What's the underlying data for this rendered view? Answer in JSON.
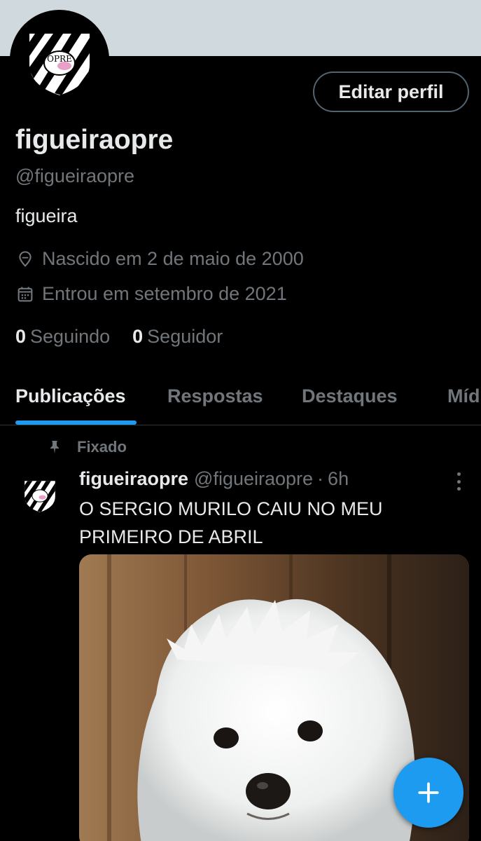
{
  "profile": {
    "display_name": "figueiraopre",
    "handle": "@figueiraopre",
    "bio": "figueira",
    "birth": "Nascido em 2 de maio de 2000",
    "joined": "Entrou em setembro de 2021",
    "following_count": "0",
    "following_label": "Seguindo",
    "followers_count": "0",
    "followers_label": "Seguidor",
    "edit_label": "Editar perfil",
    "avatar_text": "OPRE"
  },
  "tabs": [
    {
      "label": "Publicações",
      "active": true
    },
    {
      "label": "Respostas",
      "active": false
    },
    {
      "label": "Destaques",
      "active": false
    },
    {
      "label": "Míd",
      "active": false
    }
  ],
  "post": {
    "pinned_label": "Fixado",
    "author_name": "figueiraopre",
    "author_handle": "@figueiraopre",
    "separator": "·",
    "time": "6h",
    "text_lines": [
      "O SERGIO MURILO CAIU NO MEU",
      "PRIMEIRO DE ABRIL"
    ]
  },
  "colors": {
    "accent": "#1d9bf0",
    "background": "#000000",
    "primary_text": "#e7e9ea",
    "secondary_text": "#71767b",
    "banner": "#cfd9de"
  },
  "icons": {
    "location": "location-pin-icon",
    "calendar": "calendar-icon",
    "pin": "pin-icon",
    "more": "more-vertical-icon",
    "compose": "plus-icon"
  }
}
